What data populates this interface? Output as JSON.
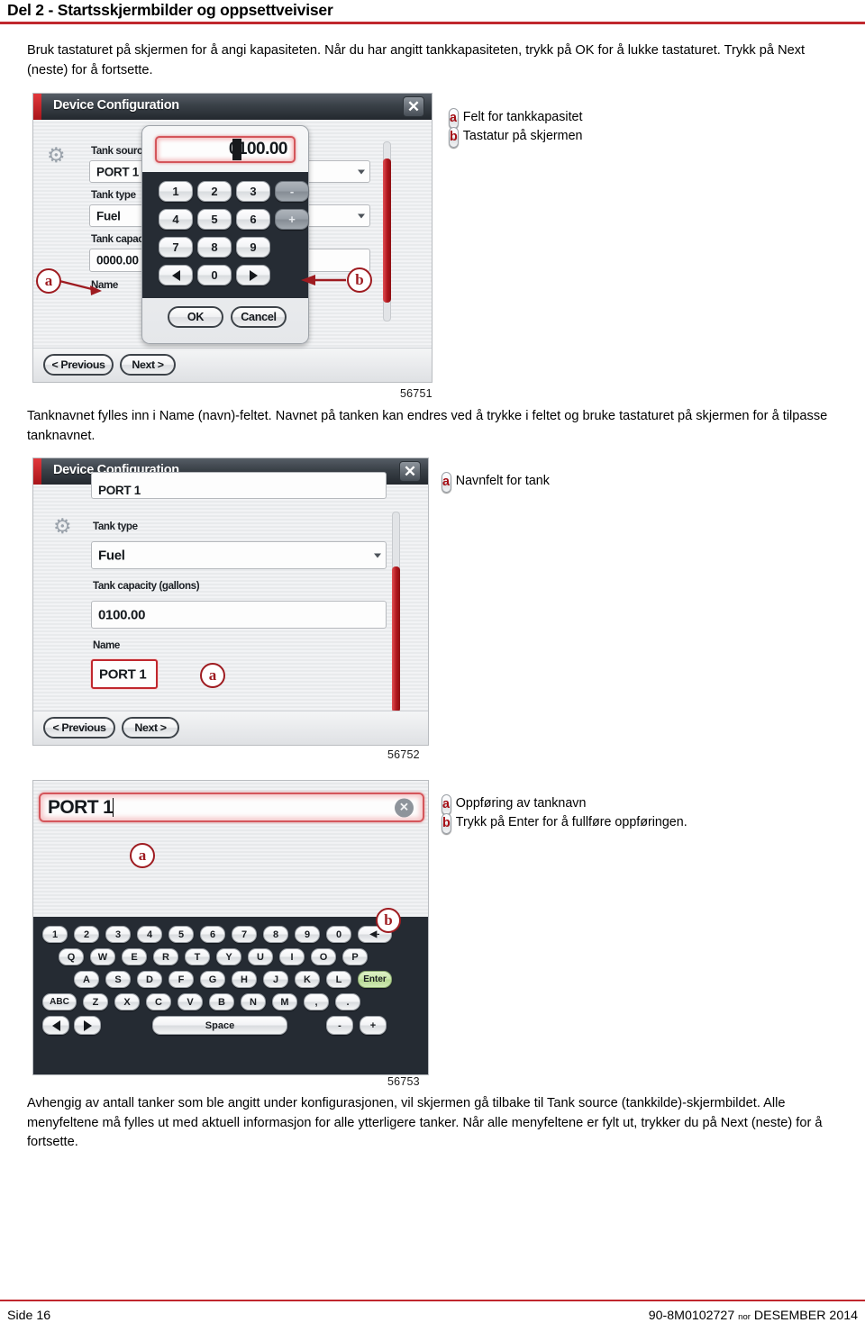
{
  "header": {
    "title": "Del 2 - Startsskjermbilder og oppsettveiviser",
    "accent_color": "#c0272d"
  },
  "intro_paragraph": "Bruk tastaturet på skjermen for å angi kapasiteten. Når du har angitt tankkapasiteten, trykk på OK for å lukke tastaturet. Trykk på Next (neste) for å fortsette.",
  "figure1": {
    "number": "56751",
    "window_title": "Device Configuration",
    "close_icon": "✕",
    "fields": [
      {
        "label": "Tank source",
        "value": "PORT 1"
      },
      {
        "label": "Tank type",
        "value": "Fuel"
      },
      {
        "label": "Tank capacity",
        "value": "0000.00"
      },
      {
        "label": "Name",
        "value": ""
      }
    ],
    "nav": {
      "previous": "< Previous",
      "next": "Next >"
    },
    "keypad": {
      "display_value": "0100.00",
      "keys_row1": [
        "1",
        "2",
        "3",
        "-"
      ],
      "keys_row2": [
        "4",
        "5",
        "6",
        "+"
      ],
      "keys_row3": [
        "7",
        "8",
        "9"
      ],
      "keys_row4": [
        "◀",
        "0",
        "▶"
      ],
      "ok_label": "OK",
      "cancel_label": "Cancel"
    },
    "callouts": [
      {
        "key": "a",
        "label": "Felt for tankkapasitet"
      },
      {
        "key": "b",
        "label": "Tastatur på skjermen"
      }
    ]
  },
  "paragraph2": "Tanknavnet fylles inn i Name (navn)-feltet. Navnet på tanken kan endres ved å trykke i feltet og bruke tastaturet på skjermen for å tilpasse tanknavnet.",
  "figure2": {
    "number": "56752",
    "window_title": "Device Configuration",
    "close_icon": "✕",
    "fields": [
      {
        "label": "",
        "value": "PORT 1"
      },
      {
        "label": "Tank type",
        "value": "Fuel"
      },
      {
        "label": "Tank capacity (gallons)",
        "value": "0100.00"
      },
      {
        "label": "Name",
        "value": "PORT 1"
      }
    ],
    "nav": {
      "previous": "< Previous",
      "next": "Next >"
    },
    "callouts": [
      {
        "key": "a",
        "label": "Navnfelt for tank"
      }
    ]
  },
  "figure3": {
    "number": "56753",
    "name_value": "PORT 1",
    "clear_icon": "✕",
    "keyboard": {
      "row1": [
        "1",
        "2",
        "3",
        "4",
        "5",
        "6",
        "7",
        "8",
        "9",
        "0",
        "◀-"
      ],
      "row2": [
        "Q",
        "W",
        "E",
        "R",
        "T",
        "Y",
        "U",
        "I",
        "O",
        "P"
      ],
      "row3": [
        "A",
        "S",
        "D",
        "F",
        "G",
        "H",
        "J",
        "K",
        "L",
        "Enter"
      ],
      "row4": [
        "ABC",
        "Z",
        "X",
        "C",
        "V",
        "B",
        "N",
        "M",
        ",",
        "."
      ],
      "row5_left": [
        "◀",
        "▶"
      ],
      "row5_space": "Space",
      "row5_right": [
        "-",
        "+"
      ]
    },
    "callouts": [
      {
        "key": "a",
        "label": "Oppføring av tanknavn"
      },
      {
        "key": "b",
        "label": "Trykk på Enter for å fullføre oppføringen."
      }
    ]
  },
  "closing_paragraph": "Avhengig av antall tanker som ble angitt under konfigurasjonen, vil skjermen gå tilbake til Tank source (tankkilde)-skjermbildet. Alle menyfeltene må fylles ut med aktuell informasjon for alle ytterligere tanker. Når alle menyfeltene er fylt ut, trykker du på Next (neste) for å fortsette.",
  "footer": {
    "page": "Side 16",
    "doc_number": "90-8M0102727",
    "language": "nor",
    "date": "DESEMBER 2014"
  }
}
